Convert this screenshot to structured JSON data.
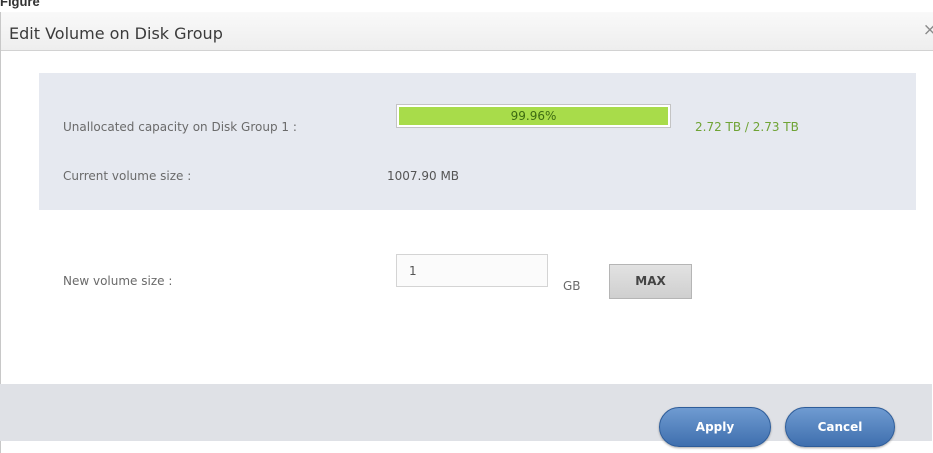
{
  "caption": {
    "figure": "Figure",
    "text": ""
  },
  "dialog": {
    "title": "Edit Volume on Disk Group",
    "close_glyph": "×"
  },
  "info": {
    "unallocated_label": "Unallocated capacity on Disk Group 1 :",
    "progress_text": "99.96%",
    "progress_fraction": 0.9996,
    "capacity_text": "2.72 TB / 2.73 TB",
    "current_label": "Current volume size :",
    "current_value": "1007.90 MB"
  },
  "form": {
    "new_size_label": "New volume size :",
    "new_size_value": "1",
    "unit": "GB",
    "max_label": "MAX"
  },
  "buttons": {
    "apply": "Apply",
    "cancel": "Cancel"
  },
  "colors": {
    "progress_fill": "#a8dc4a",
    "capacity_text": "#6fa335",
    "button_blue": "#4a7ab8",
    "panel_bg": "#e6e9f0",
    "footer_bg": "#dfe1e6"
  },
  "icons": {
    "close": "close-icon"
  }
}
